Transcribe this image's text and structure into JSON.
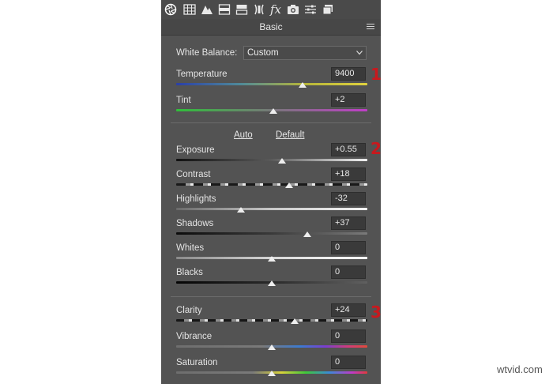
{
  "panel": {
    "tabs": [
      {
        "icon": "aperture-icon",
        "active": true
      },
      {
        "icon": "tone-curve-grid-icon"
      },
      {
        "icon": "mountains-detail-icon"
      },
      {
        "icon": "hsl-icon"
      },
      {
        "icon": "split-toning-icon"
      },
      {
        "icon": "lens-correction-icon"
      },
      {
        "icon": "fx-effects-icon",
        "glyph": "fx"
      },
      {
        "icon": "camera-calibration-icon"
      },
      {
        "icon": "presets-sliders-icon"
      },
      {
        "icon": "snapshots-icon"
      }
    ],
    "title": "Basic"
  },
  "white_balance": {
    "label": "White Balance:",
    "value": "Custom"
  },
  "sliders": {
    "temperature": {
      "label": "Temperature",
      "value": "9400",
      "position": 0.66
    },
    "tint": {
      "label": "Tint",
      "value": "+2",
      "position": 0.51
    },
    "exposure": {
      "label": "Exposure",
      "value": "+0.55",
      "position": 0.555
    },
    "contrast": {
      "label": "Contrast",
      "value": "+18",
      "position": 0.59
    },
    "highlights": {
      "label": "Highlights",
      "value": "-32",
      "position": 0.34
    },
    "shadows": {
      "label": "Shadows",
      "value": "+37",
      "position": 0.685
    },
    "whites": {
      "label": "Whites",
      "value": "0",
      "position": 0.5
    },
    "blacks": {
      "label": "Blacks",
      "value": "0",
      "position": 0.5
    },
    "clarity": {
      "label": "Clarity",
      "value": "+24",
      "position": 0.62
    },
    "vibrance": {
      "label": "Vibrance",
      "value": "0",
      "position": 0.5
    },
    "saturation": {
      "label": "Saturation",
      "value": "0",
      "position": 0.5
    }
  },
  "links": {
    "auto": "Auto",
    "default": "Default"
  },
  "markers": [
    "1",
    "2",
    "3"
  ],
  "watermark": "wtvid.com",
  "colors": {
    "panel": "#535353",
    "marker": "#c8191e",
    "thumb": "#eeeeee"
  }
}
